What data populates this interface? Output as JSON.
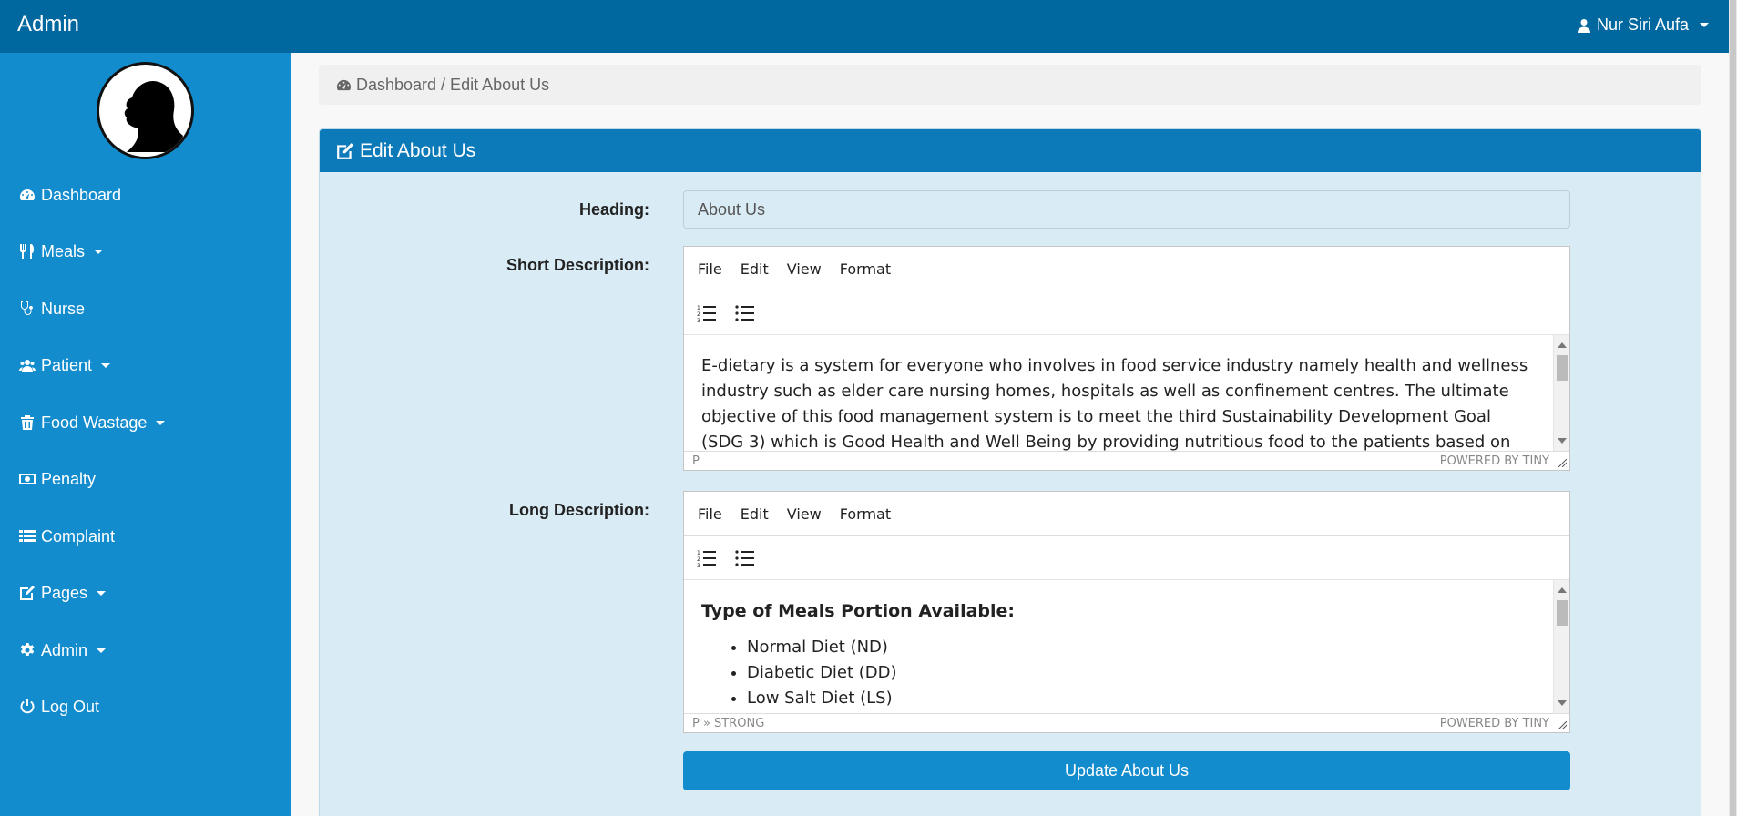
{
  "topbar": {
    "brand": "Admin",
    "user": "Nur Siri Aufa"
  },
  "sidebar": {
    "items": [
      {
        "label": "Dashboard",
        "icon": "dashboard-icon"
      },
      {
        "label": "Meals",
        "icon": "cutlery-icon"
      },
      {
        "label": "Nurse",
        "icon": "stethoscope-icon"
      },
      {
        "label": "Patient",
        "icon": "users-icon"
      },
      {
        "label": "Food Wastage",
        "icon": "trash-icon"
      },
      {
        "label": "Penalty",
        "icon": "money-icon"
      },
      {
        "label": "Complaint",
        "icon": "list-icon"
      },
      {
        "label": "Pages",
        "icon": "edit-icon"
      },
      {
        "label": "Admin",
        "icon": "gear-icon"
      },
      {
        "label": "Log Out",
        "icon": "power-icon"
      }
    ]
  },
  "breadcrumb": {
    "text": "Dashboard / Edit About Us"
  },
  "panel": {
    "title": "Edit About Us"
  },
  "form": {
    "heading_label": "Heading:",
    "heading_value": "About Us",
    "short_label": "Short Description:",
    "long_label": "Long Description:",
    "menu": {
      "file": "File",
      "edit": "Edit",
      "view": "View",
      "format": "Format"
    },
    "short_text": "E-dietary is a system for everyone who involves in food service industry namely health and wellness industry such as elder care nursing homes, hospitals as well as confinement centres.  The ultimate objective of this food management system is to meet the third Sustainability Development Goal (SDG 3) which is Good Health and Well Being by providing nutritious food to the patients based on the right",
    "short_status": "P",
    "long_heading": "Type of Meals Portion Available:",
    "long_items": [
      "Normal Diet (ND)",
      "Diabetic Diet (DD)",
      "Low Salt Diet (LS)"
    ],
    "long_status": "P » STRONG",
    "powered": "POWERED BY TINY",
    "submit": "Update About Us"
  }
}
